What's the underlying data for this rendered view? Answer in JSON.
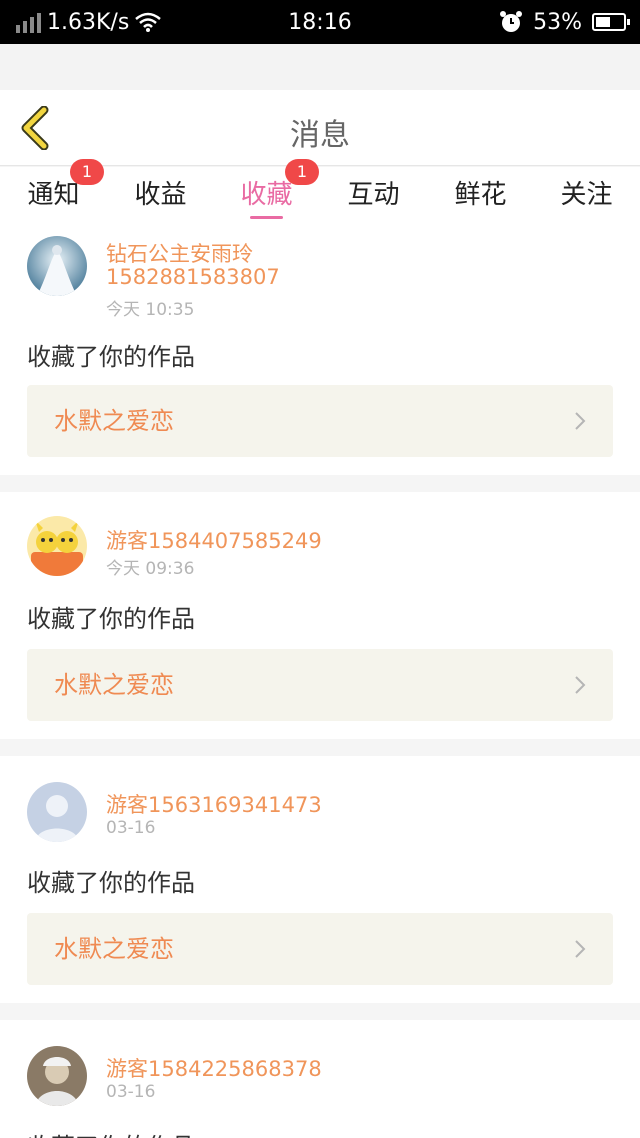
{
  "status_bar": {
    "speed": "1.63K/s",
    "time": "18:16",
    "battery": "53%"
  },
  "header": {
    "title": "消息"
  },
  "tabs": [
    {
      "label": "通知",
      "badge": "1"
    },
    {
      "label": "收益",
      "badge": ""
    },
    {
      "label": "收藏",
      "badge": "1"
    },
    {
      "label": "互动",
      "badge": ""
    },
    {
      "label": "鲜花",
      "badge": ""
    },
    {
      "label": "关注",
      "badge": ""
    }
  ],
  "active_tab": "收藏",
  "colors": {
    "accent": "#e96ba3",
    "name": "#f0955a",
    "badge": "#f04848"
  },
  "messages": [
    {
      "name": "钻石公主安雨玲",
      "id": "1582881583807",
      "time": "今天 10:35",
      "action": "收藏了你的作品",
      "work": "水默之爱恋"
    },
    {
      "name": "游客1584407585249",
      "time": "今天 09:36",
      "action": "收藏了你的作品",
      "work": "水默之爱恋"
    },
    {
      "name": "游客1563169341473",
      "time": "03-16",
      "action": "收藏了你的作品",
      "work": "水默之爱恋"
    },
    {
      "name": "游客1584225868378",
      "time": "03-16",
      "action": "收藏了你的作品",
      "work": ""
    }
  ]
}
